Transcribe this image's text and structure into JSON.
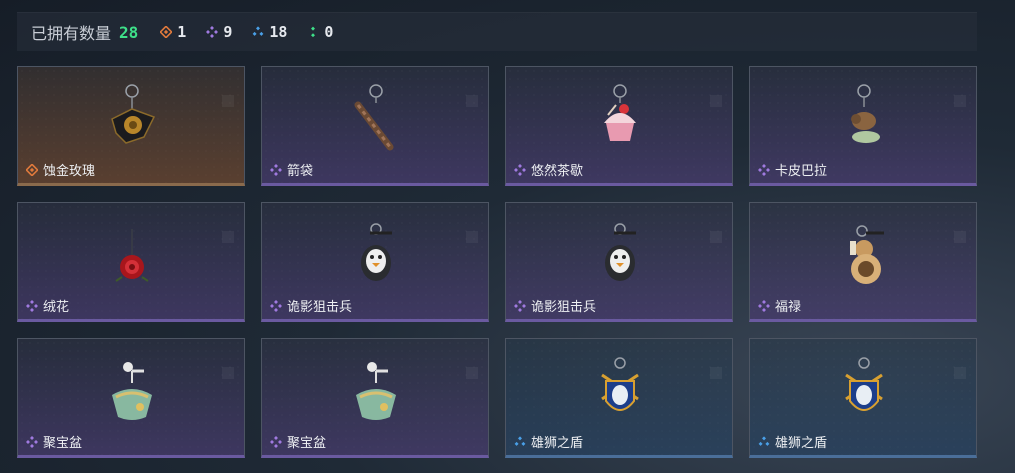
{
  "header": {
    "title": "已拥有数量",
    "total": "28",
    "stats": [
      {
        "rarity": "orange",
        "icon": "orange-rarity-icon",
        "count": "1"
      },
      {
        "rarity": "purple",
        "icon": "purple-rarity-icon",
        "count": "9"
      },
      {
        "rarity": "blue",
        "icon": "blue-rarity-icon",
        "count": "18"
      },
      {
        "rarity": "green",
        "icon": "green-rarity-icon",
        "count": "0"
      }
    ]
  },
  "colors": {
    "orange": "#e07a3c",
    "purple": "#a07ae0",
    "blue": "#4aa0e8",
    "green": "#3ee089",
    "total": "#3ee089"
  },
  "items": [
    {
      "name": "蚀金玫瑰",
      "rarity": "orange",
      "icon": "gold-rose-charm-icon"
    },
    {
      "name": "箭袋",
      "rarity": "purple",
      "icon": "quiver-charm-icon"
    },
    {
      "name": "悠然茶歇",
      "rarity": "purple",
      "icon": "cupcake-charm-icon"
    },
    {
      "name": "卡皮巴拉",
      "rarity": "purple",
      "icon": "capybara-charm-icon"
    },
    {
      "name": "绒花",
      "rarity": "purple",
      "icon": "velvet-flower-charm-icon"
    },
    {
      "name": "诡影狙击兵",
      "rarity": "purple",
      "icon": "shadow-sniper-charm-icon"
    },
    {
      "name": "诡影狙击兵",
      "rarity": "purple",
      "icon": "shadow-sniper-charm-icon"
    },
    {
      "name": "福禄",
      "rarity": "purple",
      "icon": "gourd-charm-icon"
    },
    {
      "name": "聚宝盆",
      "rarity": "purple",
      "icon": "treasure-bowl-charm-icon"
    },
    {
      "name": "聚宝盆",
      "rarity": "purple",
      "icon": "treasure-bowl-charm-icon"
    },
    {
      "name": "雄狮之盾",
      "rarity": "blue",
      "icon": "lion-shield-charm-icon"
    },
    {
      "name": "雄狮之盾",
      "rarity": "blue",
      "icon": "lion-shield-charm-icon"
    }
  ]
}
